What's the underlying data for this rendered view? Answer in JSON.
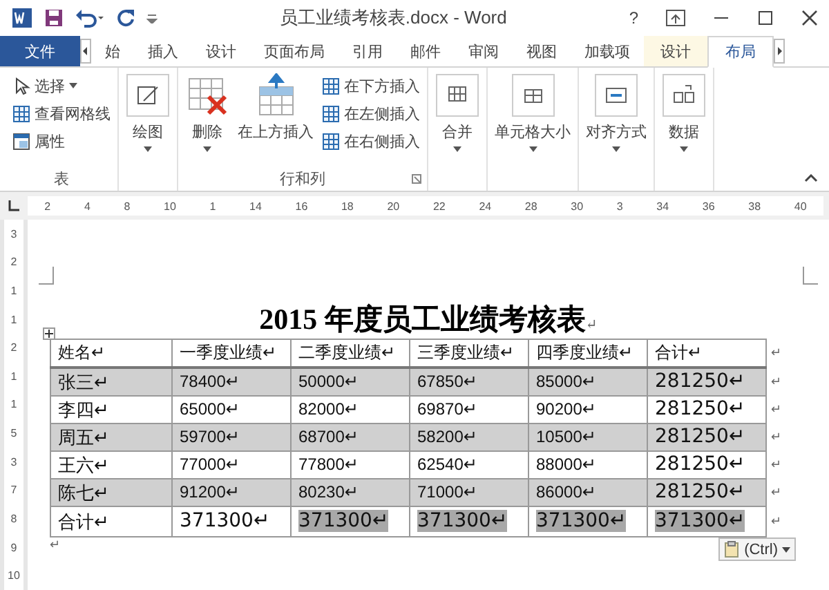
{
  "window": {
    "title": "员工业绩考核表.docx - Word",
    "help": "?"
  },
  "tabs": [
    {
      "label": "文件",
      "kind": "file",
      "selected": false
    },
    {
      "label": "始",
      "kind": "normal",
      "selected": false
    },
    {
      "label": "插入",
      "kind": "normal",
      "selected": false
    },
    {
      "label": "设计",
      "kind": "normal",
      "selected": false
    },
    {
      "label": "页面布局",
      "kind": "normal",
      "selected": false
    },
    {
      "label": "引用",
      "kind": "normal",
      "selected": false
    },
    {
      "label": "邮件",
      "kind": "normal",
      "selected": false
    },
    {
      "label": "审阅",
      "kind": "normal",
      "selected": false
    },
    {
      "label": "视图",
      "kind": "normal",
      "selected": false
    },
    {
      "label": "加载项",
      "kind": "normal",
      "selected": false
    },
    {
      "label": "设计",
      "kind": "context",
      "selected": false
    },
    {
      "label": "布局",
      "kind": "context",
      "selected": true
    }
  ],
  "ribbon": {
    "groups": [
      {
        "label": "表",
        "items": [
          {
            "label": "选择",
            "kind": "small",
            "dropdown": true
          },
          {
            "label": "查看网格线",
            "kind": "small",
            "dropdown": false
          },
          {
            "label": "属性",
            "kind": "small",
            "dropdown": false
          }
        ]
      },
      {
        "items": [
          {
            "label": "绘图",
            "kind": "large",
            "dropdown": true
          }
        ]
      },
      {
        "label": "行和列",
        "items": [
          {
            "label": "删除",
            "kind": "large",
            "dropdown": true
          },
          {
            "label": "在上方插入",
            "kind": "large",
            "dropdown": false
          },
          {
            "label": "在下方插入",
            "kind": "small",
            "dropdown": false
          },
          {
            "label": "在左侧插入",
            "kind": "small",
            "dropdown": false
          },
          {
            "label": "在右侧插入",
            "kind": "small",
            "dropdown": false
          }
        ]
      },
      {
        "items": [
          {
            "label": "合并",
            "kind": "large",
            "dropdown": true
          }
        ]
      },
      {
        "items": [
          {
            "label": "单元格大小",
            "kind": "large",
            "dropdown": true
          }
        ]
      },
      {
        "items": [
          {
            "label": "对齐方式",
            "kind": "large",
            "dropdown": true
          }
        ]
      },
      {
        "items": [
          {
            "label": "数据",
            "kind": "large",
            "dropdown": true
          }
        ]
      }
    ]
  },
  "ruler": {
    "labels": [
      "2",
      "4",
      "8",
      "10",
      "1",
      "14",
      "16",
      "18",
      "20",
      "22",
      "24",
      "28",
      "30",
      "3",
      "34",
      "36",
      "38",
      "40"
    ]
  },
  "vertical_ruler": {
    "labels": [
      "3",
      "2",
      "1",
      "1",
      "2",
      "1",
      "1",
      "5",
      "3",
      "7",
      "8",
      "9",
      "10"
    ]
  },
  "document": {
    "title": "2015 年度员工业绩考核表",
    "title_mark": "↵",
    "table": {
      "header": [
        "姓名↵",
        "一季度业绩↵",
        "二季度业绩↵",
        "三季度业绩↵",
        "四季度业绩↵",
        "合计↵"
      ],
      "rows": [
        {
          "cells": [
            "张三↵",
            "78400↵",
            "50000↵",
            "67850↵",
            "85000↵",
            "281250↵"
          ],
          "shaded": true
        },
        {
          "cells": [
            "李四↵",
            "65000↵",
            "82000↵",
            "69870↵",
            "90200↵",
            "281250↵"
          ],
          "shaded": false
        },
        {
          "cells": [
            "周五↵",
            "59700↵",
            "68700↵",
            "58200↵",
            "10500↵",
            "281250↵"
          ],
          "shaded": true
        },
        {
          "cells": [
            "王六↵",
            "77000↵",
            "77800↵",
            "62540↵",
            "88000↵",
            "281250↵"
          ],
          "shaded": false
        },
        {
          "cells": [
            "陈七↵",
            "91200↵",
            "80230↵",
            "71000↵",
            "86000↵",
            "281250↵"
          ],
          "shaded": true
        }
      ],
      "total": {
        "cells": [
          {
            "text": "合计↵",
            "selected": false
          },
          {
            "text": "371300↵",
            "selected": false
          },
          {
            "text": "371300↵",
            "selected": true
          },
          {
            "text": "371300↵",
            "selected": true
          },
          {
            "text": "371300↵",
            "selected": true
          },
          {
            "text": "371300↵",
            "selected": true
          }
        ]
      },
      "row_mark": "↵"
    },
    "end_mark": "↵",
    "paste_options": "(Ctrl)"
  }
}
